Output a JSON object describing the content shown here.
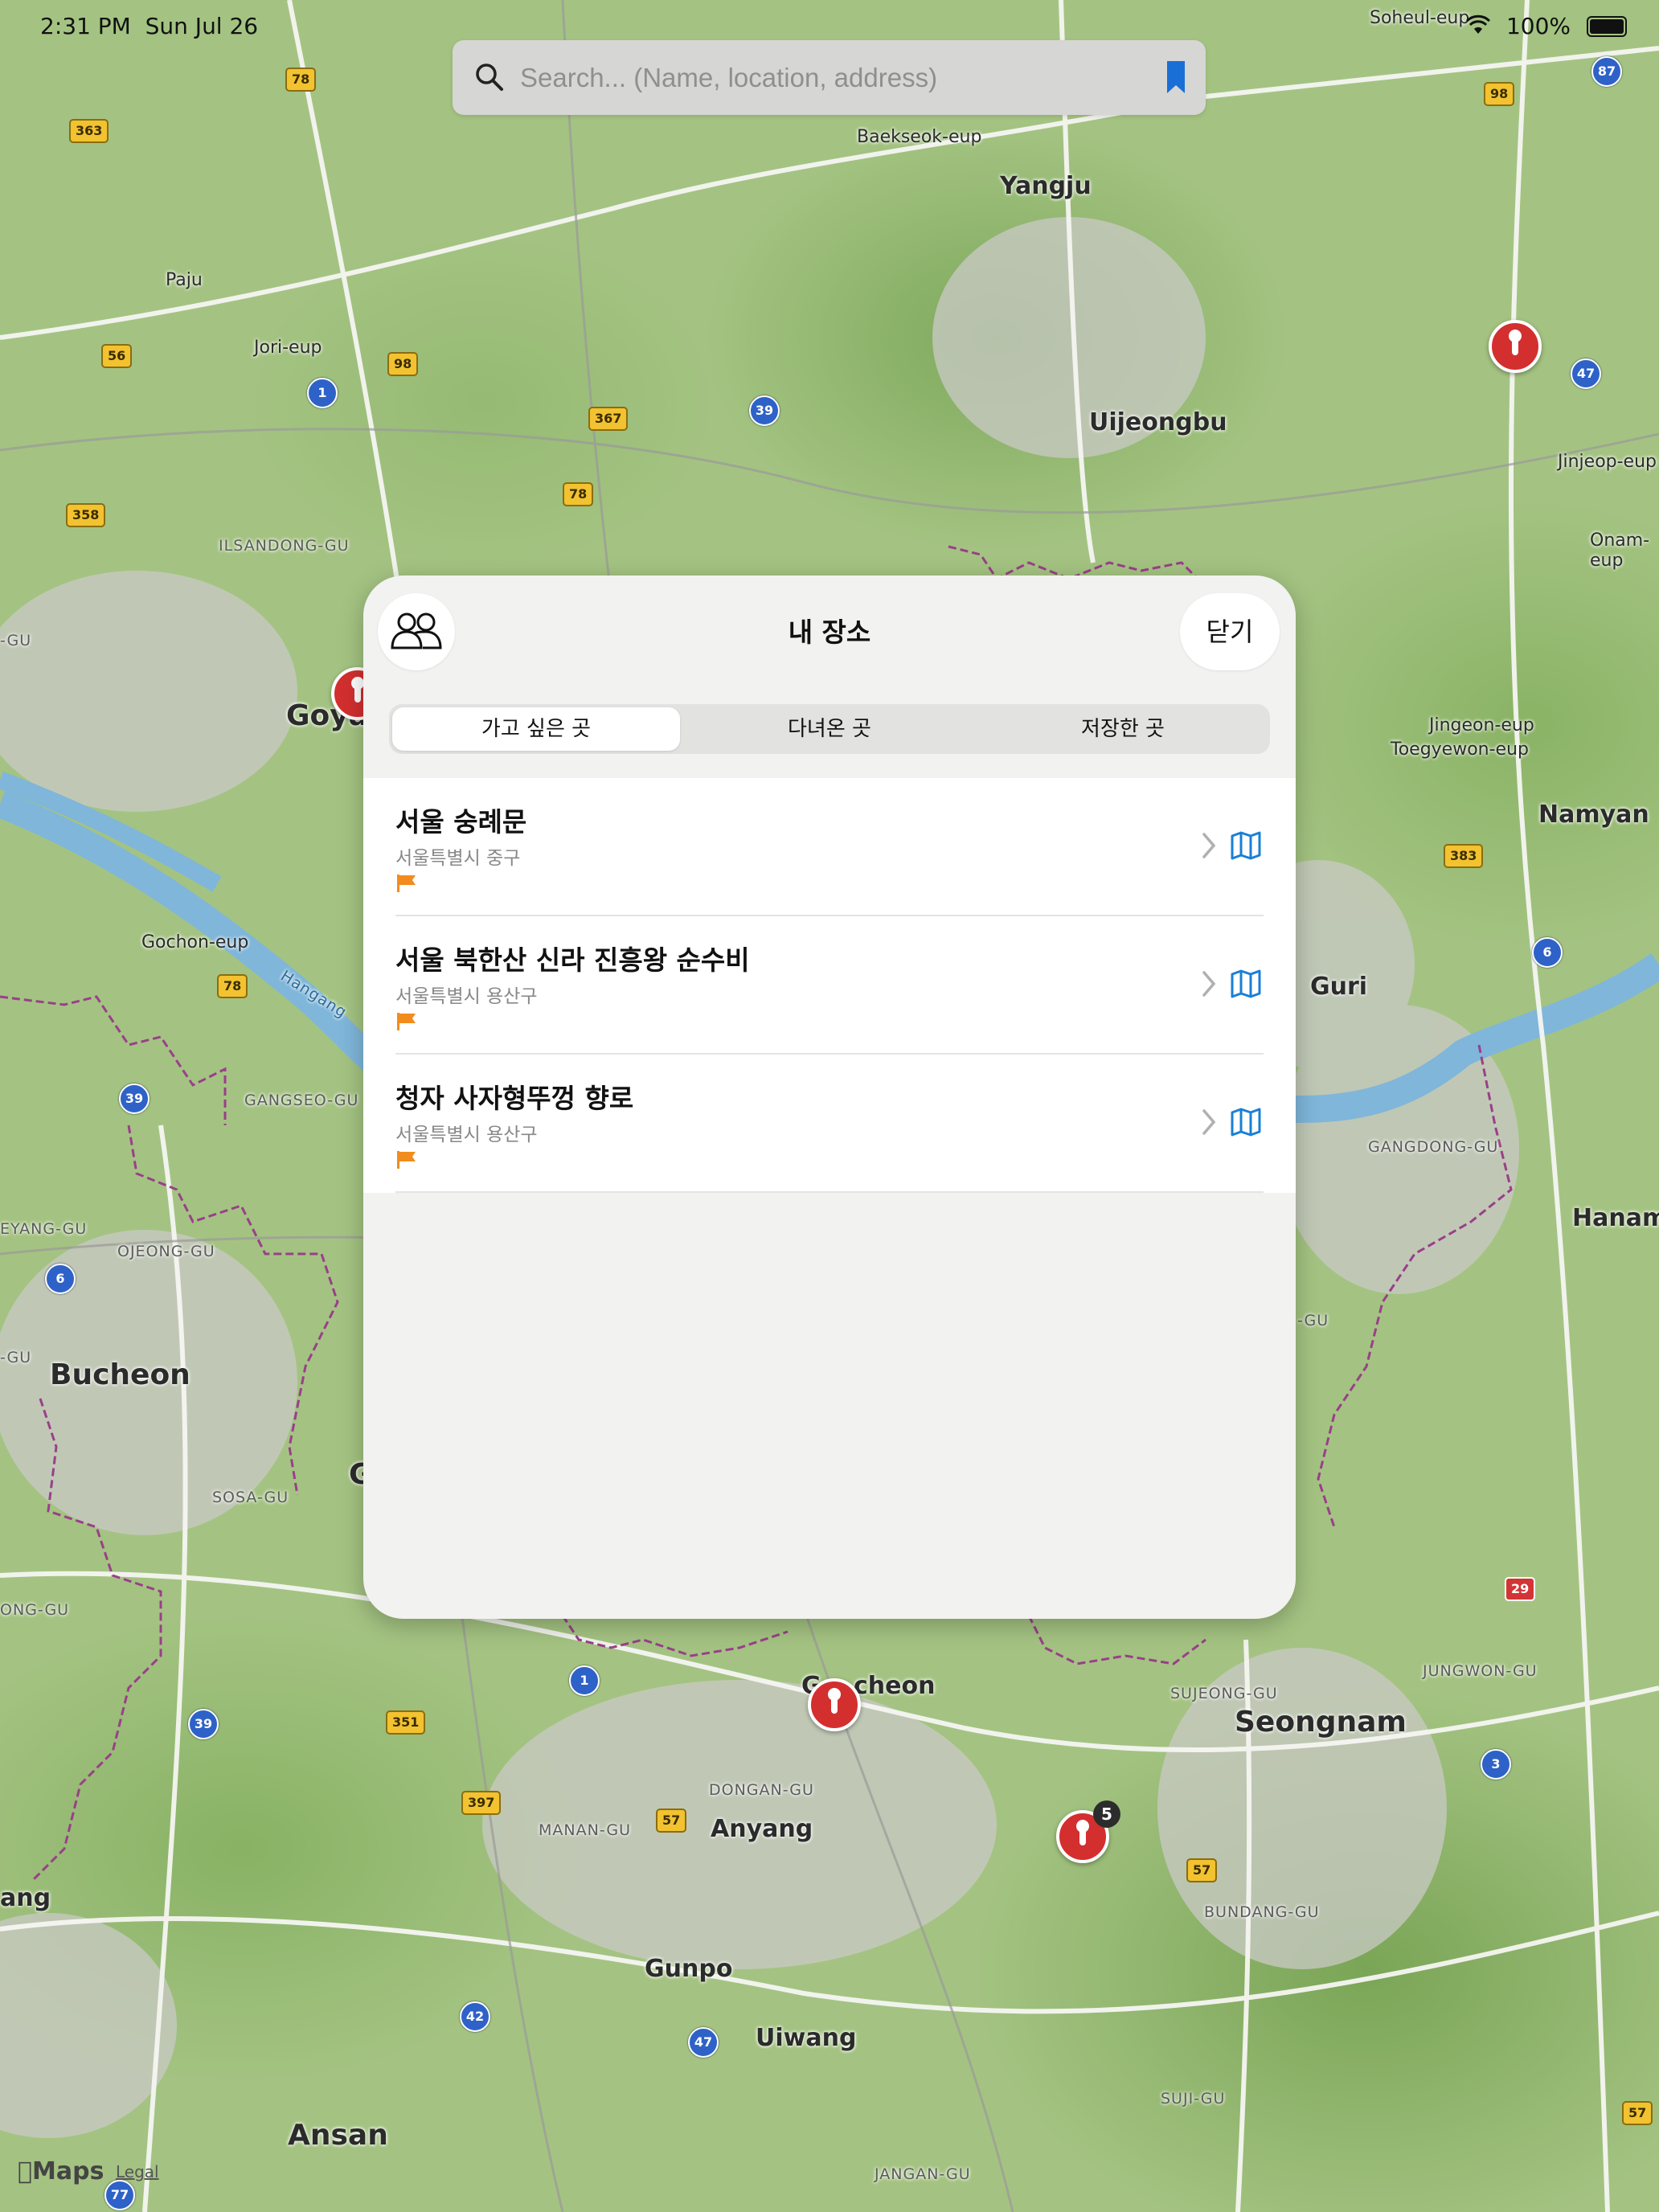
{
  "status_bar": {
    "time": "2:31 PM",
    "date": "Sun Jul 26",
    "battery": "100%"
  },
  "search": {
    "placeholder": "Search... (Name, location, address)",
    "icon": "search-icon",
    "bookmark_icon": "bookmark-icon"
  },
  "map": {
    "cities": [
      {
        "name": "Yangju",
        "size": "md"
      },
      {
        "name": "Uijeongbu",
        "size": "md"
      },
      {
        "name": "Namyan",
        "size": "md"
      },
      {
        "name": "Guri",
        "size": "md"
      },
      {
        "name": "Hanam",
        "size": "md"
      },
      {
        "name": "Bucheon",
        "size": "lg"
      },
      {
        "name": "Seongnam",
        "size": "lg"
      },
      {
        "name": "Anyang",
        "size": "md"
      },
      {
        "name": "Gunpo",
        "size": "md"
      },
      {
        "name": "Uiwang",
        "size": "md"
      },
      {
        "name": "Ansan",
        "size": "lg"
      },
      {
        "name": "Goya",
        "size": "lg"
      },
      {
        "name": "G",
        "size": "lg"
      },
      {
        "name": "G",
        "size": "md"
      },
      {
        "name": "cheon",
        "size": "md"
      },
      {
        "name": "ang",
        "size": "md"
      }
    ],
    "towns": [
      "Paju",
      "Jori-eup",
      "Baekseok-eup",
      "Soheul-eup",
      "Jinjeop-eup",
      "Onam-eup",
      "Toegyewon-eup",
      "Jingeon-eup",
      "Gochon-eup"
    ],
    "districts": [
      "ILSANDONG-GU",
      "GANGSEO-GU",
      "OJEONG-GU",
      "SOSA-GU",
      "GANGDONG-GU",
      "SUJEONG-GU",
      "DONGAN-GU",
      "MANAN-GU",
      "BUNDANG-GU",
      "JUNGWON-GU",
      "SUJI-GU",
      "JANGAN-GU",
      "-GU",
      "EYANG-GU",
      "ONG-GU",
      "-GU",
      "-GU"
    ],
    "yellow_shields": [
      "78",
      "363",
      "56",
      "98",
      "367",
      "78",
      "358",
      "98",
      "78",
      "383",
      "351",
      "397",
      "57",
      "57",
      "57"
    ],
    "blue_shields": [
      "1",
      "39",
      "87",
      "47",
      "6",
      "39",
      "6",
      "1",
      "39",
      "42",
      "47",
      "3",
      "77"
    ],
    "red_shield": "29",
    "river_label": "Hangang",
    "pin_cluster_count": "5",
    "attribution": {
      "logo": "Maps",
      "legal": "Legal"
    }
  },
  "panel": {
    "title": "내 장소",
    "close_label": "닫기",
    "friends_icon": "people-icon",
    "tabs": [
      {
        "label": "가고 싶은 곳",
        "active": true
      },
      {
        "label": "다녀온 곳",
        "active": false
      },
      {
        "label": "저장한 곳",
        "active": false
      }
    ],
    "places": [
      {
        "title": "서울 숭례문",
        "address": "서울특별시 중구",
        "flag": "flag-icon"
      },
      {
        "title": "서울 북한산 신라 진흥왕 순수비",
        "address": "서울특별시 용산구",
        "flag": "flag-icon"
      },
      {
        "title": "청자 사자형뚜껑 향로",
        "address": "서울특별시 용산구",
        "flag": "flag-icon"
      }
    ],
    "accent": "#1a7fd6",
    "flag_color": "#f28c1e"
  }
}
